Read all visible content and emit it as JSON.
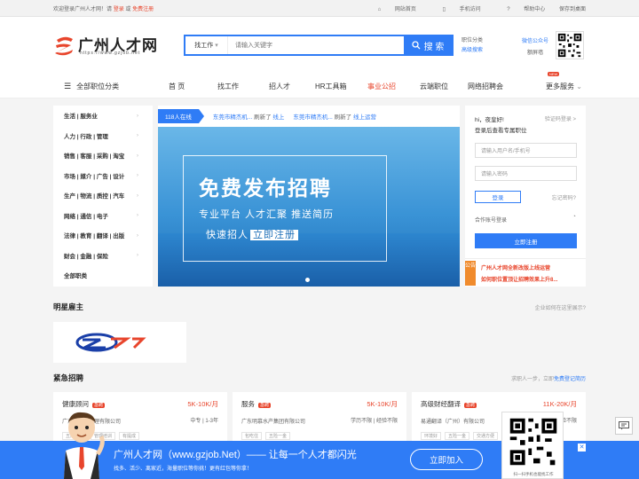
{
  "topbar": {
    "welcome": "欢迎登录广州人才网！请",
    "login": "登录",
    "or": "或",
    "register": "免费注册",
    "links": [
      "网站首页",
      "手机访问",
      "帮助中心",
      "保存到桌面"
    ]
  },
  "logo": {
    "name": "广州人才网",
    "url": "https://www.gzjob.net"
  },
  "search": {
    "type": "找工作",
    "placeholder": "请输入关键字",
    "button": "搜 索"
  },
  "header_links": {
    "category": "职位分类",
    "advanced": "高级搜索",
    "wechat": "微信公众号",
    "follow": "额屏墙"
  },
  "nav": {
    "all": "全部职位分类",
    "items": [
      "首 页",
      "找工作",
      "招人才",
      "HR工具箱",
      "事业公招",
      "云端职位",
      "网络招聘会"
    ],
    "more": "更多服务",
    "new_badge": "NEW"
  },
  "categories": [
    "生活 | 服务业",
    "人力 | 行政 | 管理",
    "销售 | 客服 | 采购 | 淘宝",
    "市场 | 媒介 | 广告 | 设计",
    "生产 | 物流 | 质控 | 汽车",
    "网络 | 通信 | 电子",
    "法律 | 教育 | 翻译 | 出版",
    "财会 | 金融 | 保险",
    "全部职类"
  ],
  "ticker": {
    "online": "118人在线",
    "items": [
      {
        "company": "东莞市精杰机...",
        "action": "刷新了",
        "target": "线上"
      },
      {
        "company": "东莞市精杰机...",
        "action": "刷新了",
        "target": "线上运营"
      }
    ]
  },
  "banner": {
    "title": "免费发布招聘",
    "line1": "专业平台  人才汇聚  推送简历",
    "line2": "快速招人",
    "cta": "立即注册"
  },
  "login": {
    "greeting": "hi，夜皇好!",
    "code_login": "验证码登录 >",
    "subtitle": "登录后查看专属职位",
    "user_placeholder": "请输入用户名/手机号",
    "pass_placeholder": "请输入密码",
    "login_btn": "登录",
    "forgot": "忘记密码?",
    "other": "合作账号登录",
    "register_btn": "立即注册",
    "notice_tag": "公告",
    "notices": [
      "广州人才网全新改版上线运营",
      "如何职位置顶让招聘效果上升8..."
    ]
  },
  "stars": {
    "title": "明星雇主",
    "right": "企业如何在这里展示?"
  },
  "urgent": {
    "title": "紧急招聘",
    "right_prefix": "求职人一步，立即",
    "right_link": "免费登记简历",
    "jobs": [
      {
        "title": "健康顾问",
        "tag": "急聘",
        "salary": "5K-10K/月",
        "company": "广东康医疗管理有限公司",
        "req": "中专 | 1-3年",
        "chips": [
          "五险一金",
          "管理培训",
          "有提成"
        ]
      },
      {
        "title": "服务",
        "tag": "急聘",
        "salary": "5K-10K/月",
        "company": "广东明慕水产集团有限公司",
        "req": "学历不限 | 经验不限",
        "chips": [
          "包吃住",
          "五险一金"
        ]
      },
      {
        "title": "高级财经翻译",
        "tag": "急聘",
        "salary": "11K-20K/月",
        "company": "易通翻译（广州）有限公司",
        "req": "经验不限",
        "chips": [
          "环境好",
          "五险一金",
          "交通方便"
        ]
      }
    ]
  },
  "bottombar": {
    "title": "广州人才网（www.gzjob.Net）—— 让每一个人才都闪光",
    "sub": "找多、活少、离家近，海量职位等你挑！更有红包等你拿！",
    "join": "立即加入",
    "close": "✕",
    "qr_label": "扫一扫手机也能找工作"
  },
  "colors": {
    "accent": "#2f7cf6",
    "brand_red": "#e8452c",
    "notice_orange": "#f08b2c"
  }
}
